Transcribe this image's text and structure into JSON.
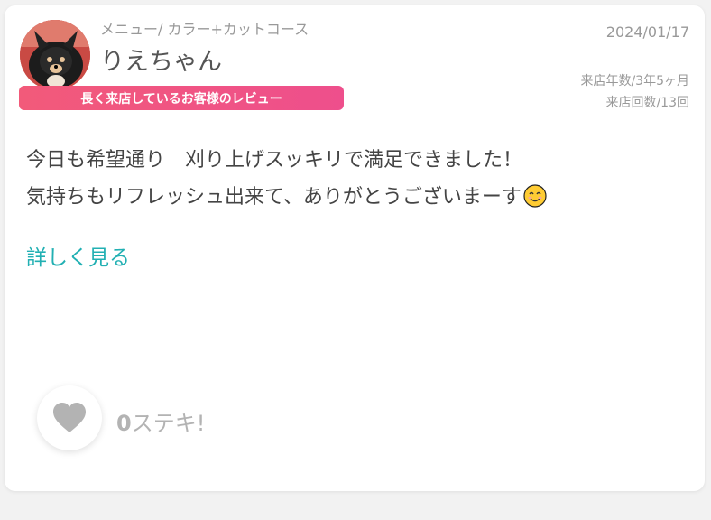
{
  "review": {
    "menu": "メニュー/ カラー+カットコース",
    "nickname": "りえちゃん",
    "badge": "長く来店しているお客様のレビュー",
    "date": "2024/01/17",
    "visit_years": "来店年数/3年5ヶ月",
    "visit_count": "来店回数/13回",
    "body_line1": "今日も希望通り　刈り上げスッキリで満足できました！",
    "body_line2": "気持ちもリフレッシュ出来て、ありがとうございまーす",
    "more_link": "詳しく見る"
  },
  "like": {
    "count": "0",
    "label": "ステキ!"
  },
  "icons": {
    "avatar": "user-avatar-dog-photo",
    "emoji": "smiling-face-emoji",
    "like": "heart-icon"
  },
  "colors": {
    "badge_start": "#f25a7a",
    "badge_end": "#ee4f8c",
    "link": "#22b0b3",
    "heart": "#b3b3b3"
  }
}
